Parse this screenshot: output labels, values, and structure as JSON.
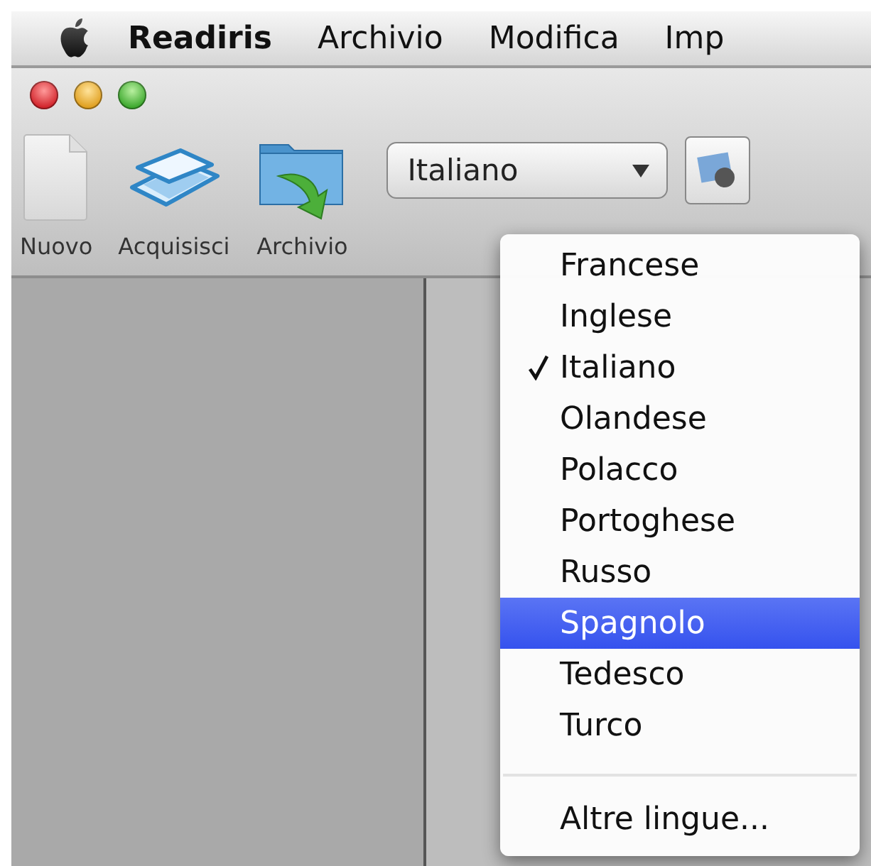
{
  "menu_bar": {
    "items": [
      {
        "label": "Readiris",
        "kind": "app"
      },
      {
        "label": "Archivio",
        "kind": "menu"
      },
      {
        "label": "Modifica",
        "kind": "menu"
      },
      {
        "label": "Imp",
        "kind": "menu"
      }
    ]
  },
  "toolbar": {
    "buttons": [
      {
        "label": "Nuovo",
        "kind": "new"
      },
      {
        "label": "Acquisisci",
        "kind": "scan"
      },
      {
        "label": "Archivio",
        "kind": "file"
      }
    ],
    "language_popup": {
      "value": "Italiano"
    }
  },
  "language_menu": {
    "items": [
      {
        "kind": "option",
        "label": "Francese",
        "checked": false,
        "selected": false
      },
      {
        "kind": "option",
        "label": "Inglese",
        "checked": false,
        "selected": false
      },
      {
        "kind": "option",
        "label": "Italiano",
        "checked": true,
        "selected": false
      },
      {
        "kind": "option",
        "label": "Olandese",
        "checked": false,
        "selected": false
      },
      {
        "kind": "option",
        "label": "Polacco",
        "checked": false,
        "selected": false
      },
      {
        "kind": "option",
        "label": "Portoghese",
        "checked": false,
        "selected": false
      },
      {
        "kind": "option",
        "label": "Russo",
        "checked": false,
        "selected": false
      },
      {
        "kind": "option",
        "label": "Spagnolo",
        "checked": false,
        "selected": true
      },
      {
        "kind": "option",
        "label": "Tedesco",
        "checked": false,
        "selected": false
      },
      {
        "kind": "option",
        "label": "Turco",
        "checked": false,
        "selected": false
      },
      {
        "kind": "separator"
      },
      {
        "kind": "option",
        "label": "Altre lingue...",
        "checked": false,
        "selected": false
      }
    ]
  }
}
